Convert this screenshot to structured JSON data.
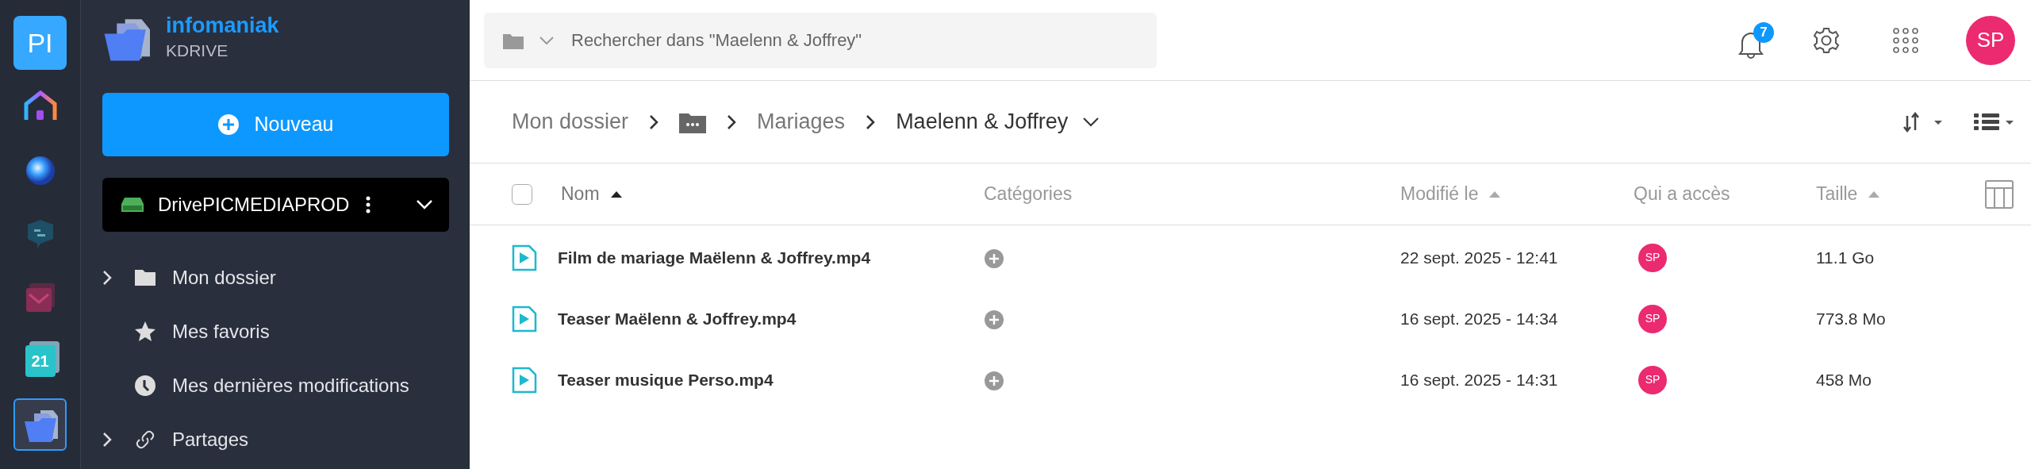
{
  "rail": {
    "avatar": "PI",
    "apps": [
      {
        "kind": "home",
        "selected": false
      },
      {
        "kind": "orb",
        "selected": false
      },
      {
        "kind": "chat",
        "selected": false
      },
      {
        "kind": "mail",
        "selected": false
      },
      {
        "kind": "calendar",
        "label": "21",
        "selected": false
      },
      {
        "kind": "drive",
        "selected": true
      }
    ]
  },
  "sidebar": {
    "brand": "infomaniak",
    "product": "KDRIVE",
    "new_button": "Nouveau",
    "drive": "DrivePICMEDIAPROD",
    "items": [
      {
        "label": "Mon dossier",
        "kind": "folder",
        "expandable": true
      },
      {
        "label": "Mes favoris",
        "kind": "star",
        "expandable": false
      },
      {
        "label": "Mes dernières modifications",
        "kind": "clock",
        "expandable": false
      },
      {
        "label": "Partages",
        "kind": "link",
        "expandable": true
      }
    ]
  },
  "topbar": {
    "search": {
      "placeholder": "Rechercher dans \"Maelenn & Joffrey\""
    },
    "notifications": "7",
    "user": "SP"
  },
  "breadcrumb": [
    {
      "kind": "text",
      "label": "Mon dossier",
      "selected": false
    },
    {
      "kind": "folder",
      "selected": false
    },
    {
      "kind": "text",
      "label": "Mariages",
      "selected": false
    },
    {
      "kind": "text",
      "label": "Maelenn & Joffrey",
      "selected": true
    }
  ],
  "table": {
    "select_all": {
      "checked": false
    },
    "columns": [
      {
        "label": "Nom",
        "sortable": true,
        "selected": true
      },
      {
        "label": "Catégories",
        "sortable": false,
        "selected": false
      },
      {
        "label": "Modifié le",
        "sortable": true,
        "selected": false
      },
      {
        "label": "Qui a accès",
        "sortable": false,
        "selected": false
      },
      {
        "label": "Taille",
        "sortable": true,
        "selected": false
      }
    ],
    "rows": [
      {
        "name": "Film de mariage Maëlenn & Joffrey.mp4",
        "modified": "22 sept. 2025 - 12:41",
        "access": "SP",
        "size": "11.1 Go"
      },
      {
        "name": "Teaser Maëlenn & Joffrey.mp4",
        "modified": "16 sept. 2025 - 14:34",
        "access": "SP",
        "size": "773.8 Mo"
      },
      {
        "name": "Teaser musique Perso.mp4",
        "modified": "16 sept. 2025 - 14:31",
        "access": "SP",
        "size": "458 Mo"
      }
    ]
  }
}
